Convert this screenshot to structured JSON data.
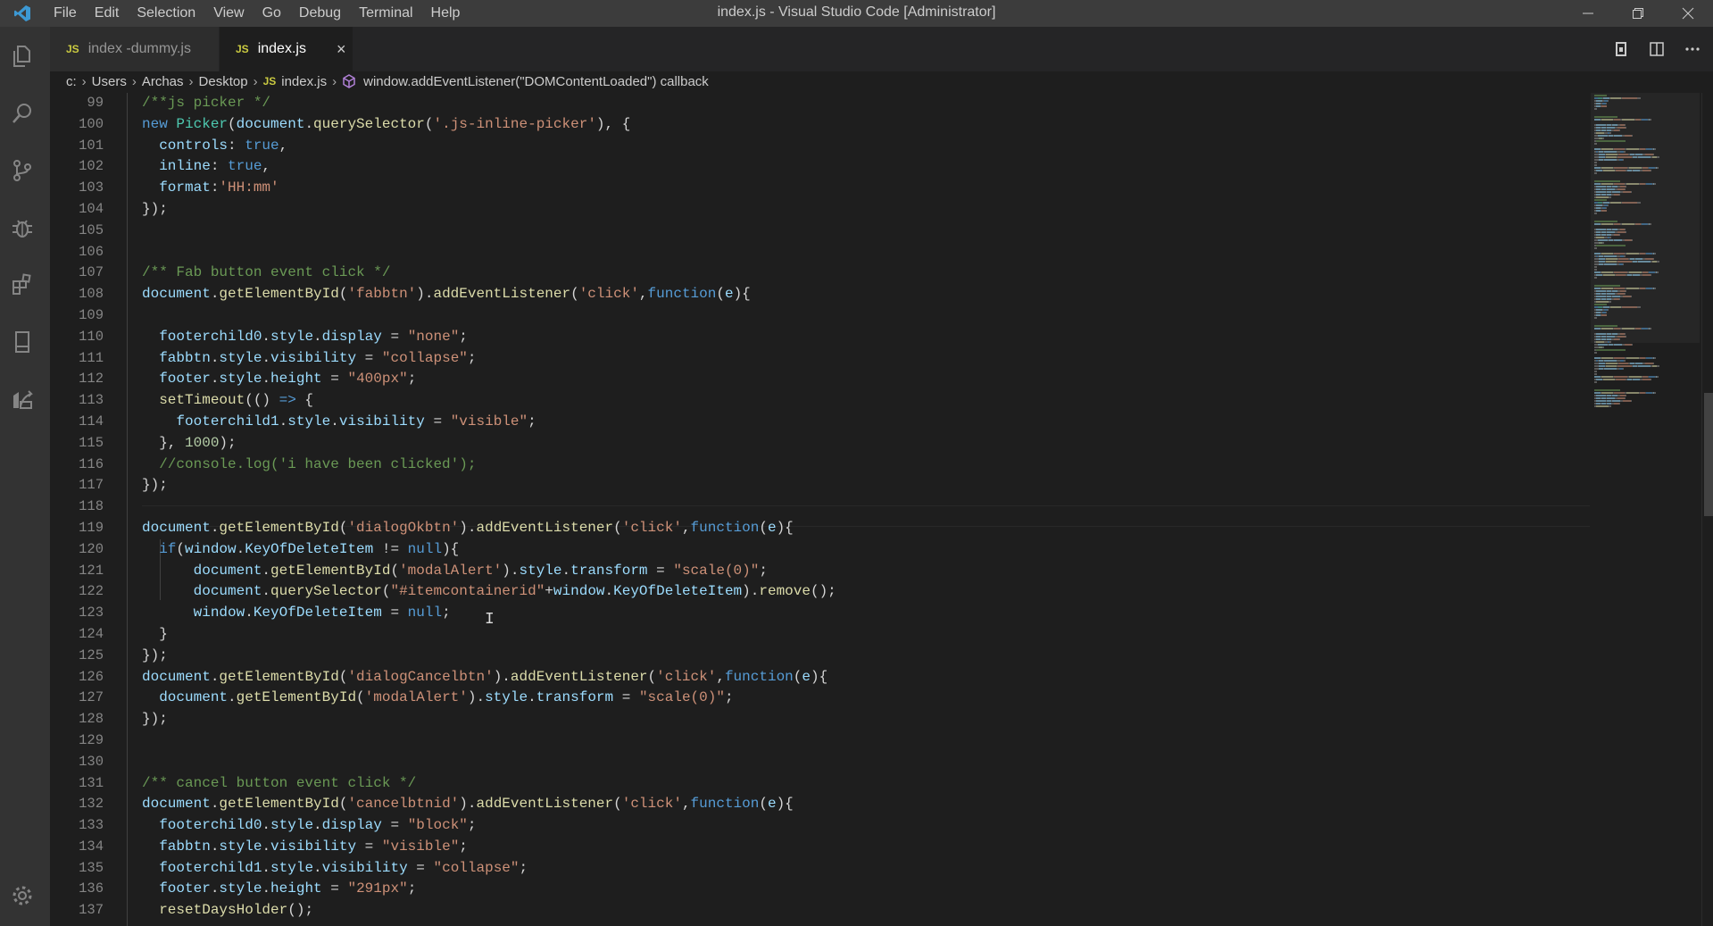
{
  "menu": [
    "File",
    "Edit",
    "Selection",
    "View",
    "Go",
    "Debug",
    "Terminal",
    "Help"
  ],
  "window_title": "index.js - Visual Studio Code [Administrator]",
  "tabs": [
    {
      "badge": "JS",
      "label": "index -dummy.js"
    },
    {
      "badge": "JS",
      "label": "index.js",
      "close": "×"
    }
  ],
  "breadcrumb": [
    "c:",
    "Users",
    "Archas",
    "Desktop",
    "JS",
    "index.js",
    "window.addEventListener(\"DOMContentLoaded\") callback"
  ],
  "gutter": [
    "99",
    "100",
    "101",
    "102",
    "103",
    "104",
    "105",
    "106",
    "107",
    "108",
    "109",
    "110",
    "111",
    "112",
    "113",
    "114",
    "115",
    "116",
    "117",
    "118",
    "119",
    "120",
    "121",
    "122",
    "123",
    "124",
    "125",
    "126",
    "127",
    "128",
    "129",
    "130",
    "131",
    "132",
    "133",
    "134",
    "135",
    "136",
    "137"
  ],
  "code_lines": [
    [
      [
        "c",
        "/**js picker */"
      ]
    ],
    [
      [
        "k",
        "new "
      ],
      [
        "t",
        "Picker"
      ],
      [
        "p",
        "("
      ],
      [
        "v",
        "document"
      ],
      [
        "p",
        "."
      ],
      [
        "f",
        "querySelector"
      ],
      [
        "p",
        "("
      ],
      [
        "s",
        "'.js-inline-picker'"
      ],
      [
        "p",
        "), {"
      ]
    ],
    [
      [
        "p",
        "  "
      ],
      [
        "v",
        "controls"
      ],
      [
        "p",
        ": "
      ],
      [
        "k",
        "true"
      ],
      [
        "p",
        ","
      ]
    ],
    [
      [
        "p",
        "  "
      ],
      [
        "v",
        "inline"
      ],
      [
        "p",
        ": "
      ],
      [
        "k",
        "true"
      ],
      [
        "p",
        ","
      ]
    ],
    [
      [
        "p",
        "  "
      ],
      [
        "v",
        "format"
      ],
      [
        "p",
        ":"
      ],
      [
        "s",
        "'HH:mm'"
      ]
    ],
    [
      [
        "p",
        "});"
      ]
    ],
    [],
    [],
    [
      [
        "c",
        "/** Fab button event click */"
      ]
    ],
    [
      [
        "v",
        "document"
      ],
      [
        "p",
        "."
      ],
      [
        "f",
        "getElementById"
      ],
      [
        "p",
        "("
      ],
      [
        "s",
        "'fabbtn'"
      ],
      [
        "p",
        ")."
      ],
      [
        "f",
        "addEventListener"
      ],
      [
        "p",
        "("
      ],
      [
        "s",
        "'click'"
      ],
      [
        "p",
        ","
      ],
      [
        "k",
        "function"
      ],
      [
        "p",
        "("
      ],
      [
        "v",
        "e"
      ],
      [
        "p",
        "){"
      ]
    ],
    [],
    [
      [
        "p",
        "  "
      ],
      [
        "v",
        "footerchild0"
      ],
      [
        "p",
        "."
      ],
      [
        "v",
        "style"
      ],
      [
        "p",
        "."
      ],
      [
        "v",
        "display"
      ],
      [
        "p",
        " = "
      ],
      [
        "s",
        "\"none\""
      ],
      [
        "p",
        ";"
      ]
    ],
    [
      [
        "p",
        "  "
      ],
      [
        "v",
        "fabbtn"
      ],
      [
        "p",
        "."
      ],
      [
        "v",
        "style"
      ],
      [
        "p",
        "."
      ],
      [
        "v",
        "visibility"
      ],
      [
        "p",
        " = "
      ],
      [
        "s",
        "\"collapse\""
      ],
      [
        "p",
        ";"
      ]
    ],
    [
      [
        "p",
        "  "
      ],
      [
        "v",
        "footer"
      ],
      [
        "p",
        "."
      ],
      [
        "v",
        "style"
      ],
      [
        "p",
        "."
      ],
      [
        "v",
        "height"
      ],
      [
        "p",
        " = "
      ],
      [
        "s",
        "\"400px\""
      ],
      [
        "p",
        ";"
      ]
    ],
    [
      [
        "p",
        "  "
      ],
      [
        "f",
        "setTimeout"
      ],
      [
        "p",
        "(() "
      ],
      [
        "k",
        "=>"
      ],
      [
        "p",
        " {"
      ]
    ],
    [
      [
        "p",
        "    "
      ],
      [
        "v",
        "footerchild1"
      ],
      [
        "p",
        "."
      ],
      [
        "v",
        "style"
      ],
      [
        "p",
        "."
      ],
      [
        "v",
        "visibility"
      ],
      [
        "p",
        " = "
      ],
      [
        "s",
        "\"visible\""
      ],
      [
        "p",
        ";"
      ]
    ],
    [
      [
        "p",
        "  }, "
      ],
      [
        "n",
        "1000"
      ],
      [
        "p",
        ");"
      ]
    ],
    [
      [
        "p",
        "  "
      ],
      [
        "c",
        "//console.log('i have been clicked');"
      ]
    ],
    [
      [
        "p",
        "});"
      ]
    ],
    [],
    [
      [
        "v",
        "document"
      ],
      [
        "p",
        "."
      ],
      [
        "f",
        "getElementById"
      ],
      [
        "p",
        "("
      ],
      [
        "s",
        "'dialogOkbtn'"
      ],
      [
        "p",
        ")."
      ],
      [
        "f",
        "addEventListener"
      ],
      [
        "p",
        "("
      ],
      [
        "s",
        "'click'"
      ],
      [
        "p",
        ","
      ],
      [
        "k",
        "function"
      ],
      [
        "p",
        "("
      ],
      [
        "v",
        "e"
      ],
      [
        "p",
        "){"
      ]
    ],
    [
      [
        "p",
        "  "
      ],
      [
        "k",
        "if"
      ],
      [
        "p",
        "("
      ],
      [
        "v",
        "window"
      ],
      [
        "p",
        "."
      ],
      [
        "v",
        "KeyOfDeleteItem"
      ],
      [
        "p",
        " != "
      ],
      [
        "k",
        "null"
      ],
      [
        "p",
        "){"
      ]
    ],
    [
      [
        "p",
        "      "
      ],
      [
        "v",
        "document"
      ],
      [
        "p",
        "."
      ],
      [
        "f",
        "getElementById"
      ],
      [
        "p",
        "("
      ],
      [
        "s",
        "'modalAlert'"
      ],
      [
        "p",
        ")."
      ],
      [
        "v",
        "style"
      ],
      [
        "p",
        "."
      ],
      [
        "v",
        "transform"
      ],
      [
        "p",
        " = "
      ],
      [
        "s",
        "\"scale(0)\""
      ],
      [
        "p",
        ";"
      ]
    ],
    [
      [
        "p",
        "      "
      ],
      [
        "v",
        "document"
      ],
      [
        "p",
        "."
      ],
      [
        "f",
        "querySelector"
      ],
      [
        "p",
        "("
      ],
      [
        "s",
        "\"#itemcontainerid\""
      ],
      [
        "p",
        "+"
      ],
      [
        "v",
        "window"
      ],
      [
        "p",
        "."
      ],
      [
        "v",
        "KeyOfDeleteItem"
      ],
      [
        "p",
        ")."
      ],
      [
        "f",
        "remove"
      ],
      [
        "p",
        "();"
      ]
    ],
    [
      [
        "p",
        "      "
      ],
      [
        "v",
        "window"
      ],
      [
        "p",
        "."
      ],
      [
        "v",
        "KeyOfDeleteItem"
      ],
      [
        "p",
        " = "
      ],
      [
        "k",
        "null"
      ],
      [
        "p",
        ";"
      ]
    ],
    [
      [
        "p",
        "  }"
      ]
    ],
    [
      [
        "p",
        "});"
      ]
    ],
    [
      [
        "v",
        "document"
      ],
      [
        "p",
        "."
      ],
      [
        "f",
        "getElementById"
      ],
      [
        "p",
        "("
      ],
      [
        "s",
        "'dialogCancelbtn'"
      ],
      [
        "p",
        ")."
      ],
      [
        "f",
        "addEventListener"
      ],
      [
        "p",
        "("
      ],
      [
        "s",
        "'click'"
      ],
      [
        "p",
        ","
      ],
      [
        "k",
        "function"
      ],
      [
        "p",
        "("
      ],
      [
        "v",
        "e"
      ],
      [
        "p",
        "){"
      ]
    ],
    [
      [
        "p",
        "  "
      ],
      [
        "v",
        "document"
      ],
      [
        "p",
        "."
      ],
      [
        "f",
        "getElementById"
      ],
      [
        "p",
        "("
      ],
      [
        "s",
        "'modalAlert'"
      ],
      [
        "p",
        ")."
      ],
      [
        "v",
        "style"
      ],
      [
        "p",
        "."
      ],
      [
        "v",
        "transform"
      ],
      [
        "p",
        " = "
      ],
      [
        "s",
        "\"scale(0)\""
      ],
      [
        "p",
        ";"
      ]
    ],
    [
      [
        "p",
        "});"
      ]
    ],
    [],
    [],
    [
      [
        "c",
        "/** cancel button event click */"
      ]
    ],
    [
      [
        "v",
        "document"
      ],
      [
        "p",
        "."
      ],
      [
        "f",
        "getElementById"
      ],
      [
        "p",
        "("
      ],
      [
        "s",
        "'cancelbtnid'"
      ],
      [
        "p",
        ")."
      ],
      [
        "f",
        "addEventListener"
      ],
      [
        "p",
        "("
      ],
      [
        "s",
        "'click'"
      ],
      [
        "p",
        ","
      ],
      [
        "k",
        "function"
      ],
      [
        "p",
        "("
      ],
      [
        "v",
        "e"
      ],
      [
        "p",
        "){"
      ]
    ],
    [
      [
        "p",
        "  "
      ],
      [
        "v",
        "footerchild0"
      ],
      [
        "p",
        "."
      ],
      [
        "v",
        "style"
      ],
      [
        "p",
        "."
      ],
      [
        "v",
        "display"
      ],
      [
        "p",
        " = "
      ],
      [
        "s",
        "\"block\""
      ],
      [
        "p",
        ";"
      ]
    ],
    [
      [
        "p",
        "  "
      ],
      [
        "v",
        "fabbtn"
      ],
      [
        "p",
        "."
      ],
      [
        "v",
        "style"
      ],
      [
        "p",
        "."
      ],
      [
        "v",
        "visibility"
      ],
      [
        "p",
        " = "
      ],
      [
        "s",
        "\"visible\""
      ],
      [
        "p",
        ";"
      ]
    ],
    [
      [
        "p",
        "  "
      ],
      [
        "v",
        "footerchild1"
      ],
      [
        "p",
        "."
      ],
      [
        "v",
        "style"
      ],
      [
        "p",
        "."
      ],
      [
        "v",
        "visibility"
      ],
      [
        "p",
        " = "
      ],
      [
        "s",
        "\"collapse\""
      ],
      [
        "p",
        ";"
      ]
    ],
    [
      [
        "p",
        "  "
      ],
      [
        "v",
        "footer"
      ],
      [
        "p",
        "."
      ],
      [
        "v",
        "style"
      ],
      [
        "p",
        "."
      ],
      [
        "v",
        "height"
      ],
      [
        "p",
        " = "
      ],
      [
        "s",
        "\"291px\""
      ],
      [
        "p",
        ";"
      ]
    ],
    [
      [
        "p",
        "  "
      ],
      [
        "f",
        "resetDaysHolder"
      ],
      [
        "p",
        "();"
      ]
    ]
  ],
  "colors": {
    "comment": "#6a9955",
    "keyword": "#569cd6",
    "function": "#dcdcaa",
    "string": "#ce9178",
    "number": "#b5cea8",
    "variable": "#9cdcfe",
    "type": "#4ec9b0",
    "plain": "#d4d4d4",
    "editor_bg": "#1e1e1e",
    "titlebar_bg": "#3c3c3c",
    "activity_bg": "#333333",
    "vscode_blue": "#3c99d4"
  },
  "icons": {
    "activity": [
      "explorer-icon",
      "search-icon",
      "source-control-icon",
      "debug-icon",
      "extensions-icon",
      "remote-explorer-icon",
      "live-share-icon",
      "settings-gear-icon"
    ],
    "editor_actions": [
      "open-changes-icon",
      "split-editor-icon",
      "more-actions-icon"
    ],
    "window": [
      "minimize-icon",
      "restore-icon",
      "close-icon"
    ]
  }
}
